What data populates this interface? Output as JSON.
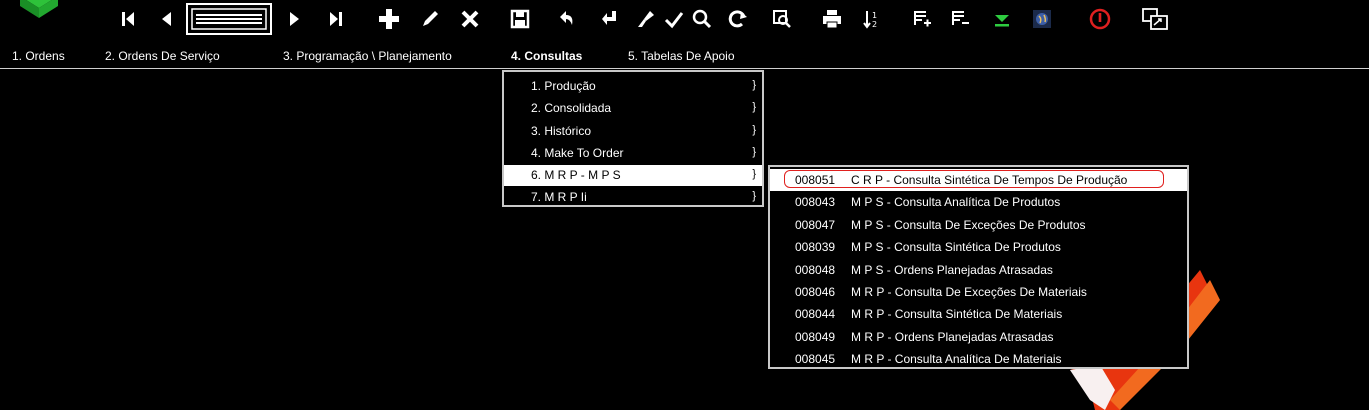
{
  "toolbar": {
    "icons": [
      "logo-icon",
      "first-record-icon",
      "previous-record-icon",
      "list-view-icon",
      "next-record-icon",
      "last-record-icon",
      "add-icon",
      "edit-icon",
      "delete-icon",
      "save-icon",
      "undo-icon",
      "confirm-icon",
      "clear-icon",
      "check-icon",
      "search-icon",
      "refresh-icon",
      "zoom-icon",
      "print-icon",
      "sort-icon",
      "insert-row-icon",
      "remove-row-icon",
      "download-icon",
      "globe-icon",
      "power-icon",
      "window-switch-icon"
    ]
  },
  "menubar": {
    "items": [
      {
        "label": "1. Ordens"
      },
      {
        "label": "2. Ordens De Serviço"
      },
      {
        "label": "3. Programação \\ Planejamento"
      },
      {
        "label": "4. Consultas"
      },
      {
        "label": "5. Tabelas De Apoio"
      }
    ]
  },
  "dropdown": {
    "items": [
      {
        "label": "1. Produção",
        "arrow": "}"
      },
      {
        "label": "2. Consolidada",
        "arrow": "}"
      },
      {
        "label": "3. Histórico",
        "arrow": "}"
      },
      {
        "label": "4. Make To Order",
        "arrow": "}"
      },
      {
        "label": "6. M R P - M P S",
        "arrow": "}"
      },
      {
        "label": "7. M R P  Ii",
        "arrow": "}"
      }
    ]
  },
  "submenu": {
    "items": [
      {
        "code": "008051",
        "desc": "C R P  - Consulta Sintética De Tempos De Produção"
      },
      {
        "code": "008043",
        "desc": "M P S  - Consulta Analítica De Produtos"
      },
      {
        "code": "008047",
        "desc": "M P S  - Consulta De Exceções De Produtos"
      },
      {
        "code": "008039",
        "desc": "M P S  - Consulta Sintética De Produtos"
      },
      {
        "code": "008048",
        "desc": "M P S  - Ordens Planejadas Atrasadas"
      },
      {
        "code": "008046",
        "desc": "M R P  - Consulta De Exceções De Materiais"
      },
      {
        "code": "008044",
        "desc": "M R P  - Consulta Sintética De Materiais"
      },
      {
        "code": "008049",
        "desc": "M R P  - Ordens Planejadas Atrasadas"
      },
      {
        "code": "008045",
        "desc": "M R P - Consulta Analítica De Materiais"
      }
    ]
  },
  "colors": {
    "background": "#000000",
    "highlight": "#ffffff",
    "outline": "#e0201e",
    "download": "#2ecc40",
    "power": "#e02020"
  }
}
